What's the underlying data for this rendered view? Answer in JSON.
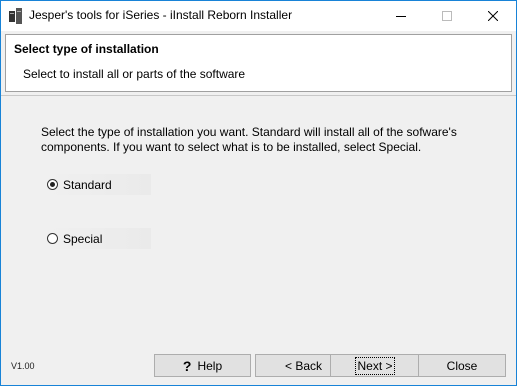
{
  "window": {
    "title": "Jesper's tools for iSeries - iInstall Reborn Installer"
  },
  "header": {
    "title": "Select type of installation",
    "subtitle": "Select to install all or parts of the software"
  },
  "body": {
    "description": "Select the type of installation you want. Standard will install all of the sofware's components. If you want to select what is to be installed, select Special.",
    "options": [
      {
        "label": "Standard",
        "selected": true
      },
      {
        "label": "Special",
        "selected": false
      }
    ]
  },
  "footer": {
    "version": "V1.00",
    "help_label": "Help",
    "back_label": "< Back",
    "next_label": "Next >",
    "close_label": "Close"
  },
  "colors": {
    "window_border": "#1883d7",
    "background": "#f0f0f0",
    "button_face": "#e1e1e1"
  }
}
